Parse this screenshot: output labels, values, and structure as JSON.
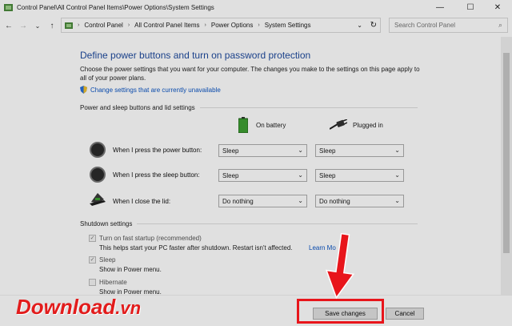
{
  "window": {
    "title": "Control Panel\\All Control Panel Items\\Power Options\\System Settings",
    "minimize": "—",
    "maximize": "☐",
    "close": "✕"
  },
  "nav": {
    "back": "←",
    "forward": "→",
    "recent": "⌄",
    "up": "↑",
    "refresh": "↻"
  },
  "address": {
    "crumbs": [
      "Control Panel",
      "All Control Panel Items",
      "Power Options",
      "System Settings"
    ],
    "separator": "›",
    "dropdown": "⌄"
  },
  "search": {
    "placeholder": "Search Control Panel"
  },
  "main": {
    "heading": "Define power buttons and turn on password protection",
    "description": "Choose the power settings that you want for your computer. The changes you make to the settings on this page apply to all of your power plans.",
    "change_link": "Change settings that are currently unavailable",
    "section1": "Power and sleep buttons and lid settings",
    "col_battery": "On battery",
    "col_plugged": "Plugged in",
    "rows": [
      {
        "label": "When I press the power button:",
        "battery": "Sleep",
        "plugged": "Sleep"
      },
      {
        "label": "When I press the sleep button:",
        "battery": "Sleep",
        "plugged": "Sleep"
      },
      {
        "label": "When I close the lid:",
        "battery": "Do nothing",
        "plugged": "Do nothing"
      }
    ],
    "section2": "Shutdown settings",
    "fast_startup": {
      "label": "Turn on fast startup (recommended)",
      "desc": "This helps start your PC faster after shutdown. Restart isn't affected.",
      "link": "Learn Mo",
      "checked": true
    },
    "sleep": {
      "label": "Sleep",
      "desc": "Show in Power menu.",
      "checked": true
    },
    "hibernate": {
      "label": "Hibernate",
      "desc": "Show in Power menu.",
      "checked": false
    }
  },
  "footer": {
    "save": "Save changes",
    "cancel": "Cancel"
  },
  "watermark": {
    "main": "Download",
    "suffix": ".vn"
  },
  "colors": {
    "heading": "#1e4a9e",
    "link": "#0b55c4",
    "highlight": "#e8151b"
  }
}
